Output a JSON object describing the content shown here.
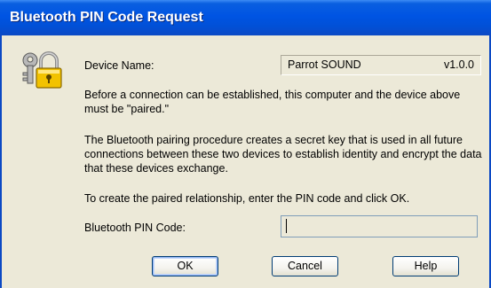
{
  "window": {
    "title": "Bluetooth PIN Code Request"
  },
  "device": {
    "label": "Device Name:",
    "name": "Parrot SOUND",
    "version": "v1.0.0"
  },
  "text": {
    "paragraph1": "Before a connection can be established, this computer and the device above must be \"paired.\"",
    "paragraph2": "The Bluetooth pairing procedure creates a secret key that is used in all future connections between these two devices to establish identity and encrypt the data that these devices exchange.",
    "paragraph3": "To create the paired relationship, enter the PIN code and click OK."
  },
  "pin": {
    "label": "Bluetooth PIN Code:",
    "value": ""
  },
  "buttons": {
    "ok": "OK",
    "cancel": "Cancel",
    "help": "Help"
  },
  "icons": {
    "dialog_icon": "lock-keys-icon"
  },
  "colors": {
    "titlebar": "#0054e3",
    "dialog_bg": "#ece9d8",
    "button_border": "#003c74"
  }
}
